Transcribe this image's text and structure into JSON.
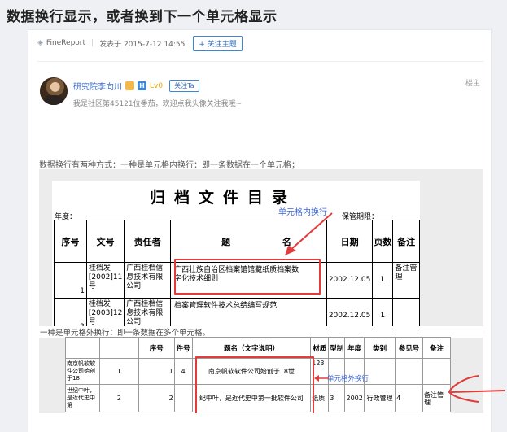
{
  "post": {
    "title": "数据换行显示，或者换到下一个单元格显示",
    "category": "FineReport",
    "posted": "发表于 2015-7-12 14:55",
    "follow_topic": "+ 关注主题"
  },
  "author": {
    "name": "研究院李向川",
    "level": "Lv0",
    "follow": "关注Ta",
    "intro": "我是社区第45121位番茄，欢迎点我头像关注我哦~",
    "floor": "楼主"
  },
  "body": {
    "intro": "数据换行有两种方式：一种是单元格内换行：即一条数据在一个单元格；",
    "second": "一种是单元格外换行：即一条数据在多个单元格。"
  },
  "doc": {
    "title": "归档文件目录",
    "year_label": "年度：",
    "keep_label": "保管期限：",
    "annotation": "单元格内换行",
    "headers": [
      "序号",
      "文号",
      "责任者",
      "题",
      "名",
      "日期",
      "页数",
      "备注"
    ],
    "rows": [
      {
        "no": "1",
        "file": "桂档发[2002]11号",
        "owner": "广西桂档信息技术有限公司",
        "title": "广西壮族自治区档案馆馆藏纸质档案数字化技术细则",
        "date": "2002.12.05",
        "pages": "1",
        "remark": "备注管理"
      },
      {
        "no": "2",
        "file": "桂档发[2003]12号",
        "owner": "广西桂档信息技术有限公司",
        "title": "档案管理软件技术总结编写规范",
        "date": "2002.12.05",
        "pages": "1",
        "remark": ""
      }
    ]
  },
  "ext": {
    "annotation": "单元格外换行",
    "headers": [
      "序号",
      "件号",
      "题名（文字说明）",
      "材质",
      "型制",
      "年度",
      "类别",
      "参见号",
      "备注"
    ],
    "rows": [
      {
        "left": "南京帆软软件公司始创于18",
        "no": "1",
        "item": "1",
        "item2": "4",
        "title": "南京帆软软件公司始创于18世",
        "mat": "123",
        "type": "",
        "year": "",
        "cat": "",
        "ref": "",
        "remark": ""
      },
      {
        "left": "世纪中叶，是近代史中第",
        "no": "2",
        "item": "2",
        "item2": "",
        "title": "纪中叶，是近代史中第一批软件公司",
        "mat": "纸质",
        "type": "3",
        "year": "2002",
        "cat": "行政管理",
        "ref": "4",
        "remark": "备注管理"
      }
    ]
  },
  "colors": {
    "accent": "#2d6ec5",
    "annotation_red": "#e23b3b",
    "annotation_blue": "#3a62d8"
  }
}
